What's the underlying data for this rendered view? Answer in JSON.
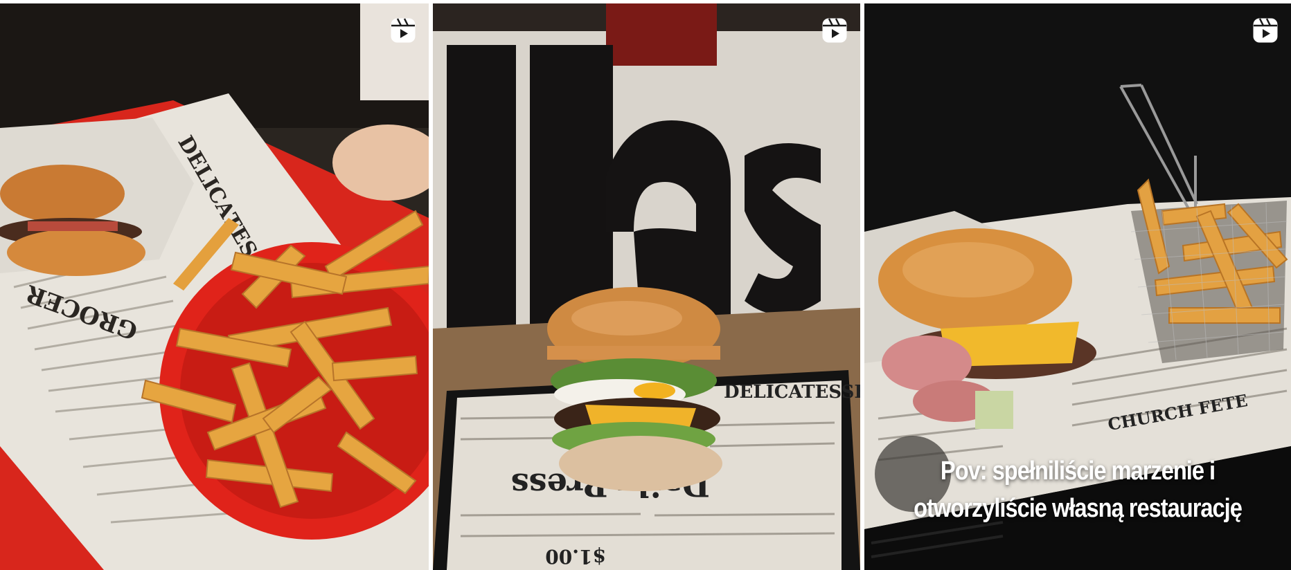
{
  "posts": [
    {
      "type": "reel",
      "icon": "reel-icon",
      "caption": ""
    },
    {
      "type": "reel",
      "icon": "reel-icon",
      "caption": ""
    },
    {
      "type": "reel",
      "icon": "reel-icon",
      "caption_lines": [
        "Pov: spełniliście marzenie i",
        "otworzyliście własną restaurację"
      ]
    }
  ],
  "colors": {
    "tray_red": "#d8261c",
    "basket_red": "#e0231a",
    "fries": "#e4a03d",
    "bun": "#d98f3e",
    "background_dark": "#111111"
  }
}
